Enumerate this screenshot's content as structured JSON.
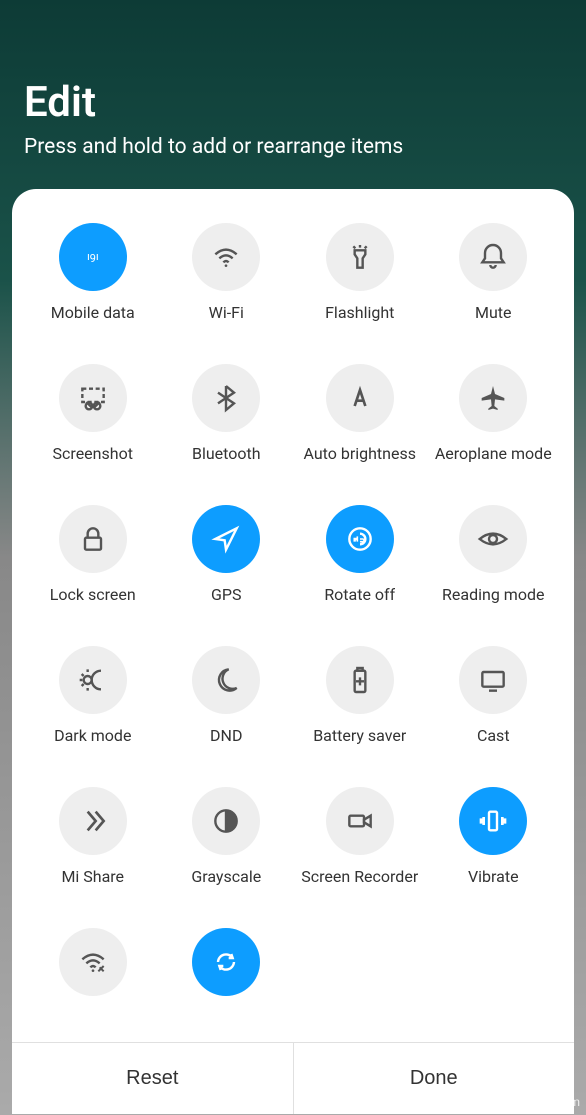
{
  "header": {
    "title": "Edit",
    "subtitle": "Press and hold to add or rearrange items"
  },
  "tiles": [
    {
      "label": "Mobile data",
      "active": true,
      "icon": "mobile-data"
    },
    {
      "label": "Wi-Fi",
      "active": false,
      "icon": "wifi"
    },
    {
      "label": "Flashlight",
      "active": false,
      "icon": "flashlight"
    },
    {
      "label": "Mute",
      "active": false,
      "icon": "bell"
    },
    {
      "label": "Screenshot",
      "active": false,
      "icon": "screenshot"
    },
    {
      "label": "Bluetooth",
      "active": false,
      "icon": "bluetooth"
    },
    {
      "label": "Auto brightness",
      "active": false,
      "icon": "brightness-a"
    },
    {
      "label": "Aeroplane mode",
      "active": false,
      "icon": "airplane"
    },
    {
      "label": "Lock screen",
      "active": false,
      "icon": "lock"
    },
    {
      "label": "GPS",
      "active": true,
      "icon": "location"
    },
    {
      "label": "Rotate off",
      "active": true,
      "icon": "rotate"
    },
    {
      "label": "Reading mode",
      "active": false,
      "icon": "eye"
    },
    {
      "label": "Dark mode",
      "active": false,
      "icon": "dark-mode"
    },
    {
      "label": "DND",
      "active": false,
      "icon": "moon"
    },
    {
      "label": "Battery saver",
      "active": false,
      "icon": "battery"
    },
    {
      "label": "Cast",
      "active": false,
      "icon": "cast"
    },
    {
      "label": "Mi Share",
      "active": false,
      "icon": "share"
    },
    {
      "label": "Grayscale",
      "active": false,
      "icon": "grayscale"
    },
    {
      "label": "Screen Recorder",
      "active": false,
      "icon": "recorder"
    },
    {
      "label": "Vibrate",
      "active": true,
      "icon": "vibrate"
    },
    {
      "label": "",
      "active": false,
      "icon": "wifi-edit"
    },
    {
      "label": "",
      "active": true,
      "icon": "sync"
    }
  ],
  "footer": {
    "reset": "Reset",
    "done": "Done"
  },
  "watermark": "wsxdn.com"
}
